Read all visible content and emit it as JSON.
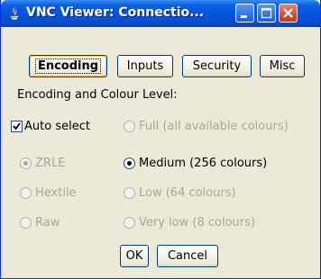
{
  "window": {
    "title": "VNC Viewer: Connectio..."
  },
  "tabs": [
    {
      "label": "Encoding",
      "active": true
    },
    {
      "label": "Inputs"
    },
    {
      "label": "Security"
    },
    {
      "label": "Misc"
    }
  ],
  "section": {
    "heading": "Encoding and Colour Level:"
  },
  "options": {
    "auto_select": {
      "label": "Auto select",
      "checked": true
    },
    "full": {
      "label": "Full (all available colours)",
      "enabled": false
    },
    "zrle": {
      "label": "ZRLE",
      "enabled": false,
      "selected": true
    },
    "medium": {
      "label": "Medium (256 colours)",
      "enabled": true,
      "selected": true
    },
    "hextile": {
      "label": "Hextile",
      "enabled": false
    },
    "low": {
      "label": "Low (64 colours)",
      "enabled": false
    },
    "raw": {
      "label": "Raw",
      "enabled": false
    },
    "very_low": {
      "label": "Very low (8 colours)",
      "enabled": false
    }
  },
  "footer": {
    "ok_label": "OK",
    "cancel_label": "Cancel"
  },
  "colors": {
    "titlebar": "#0553dc",
    "dialog_bg": "#ece9d8",
    "close_button": "#c3361a"
  }
}
